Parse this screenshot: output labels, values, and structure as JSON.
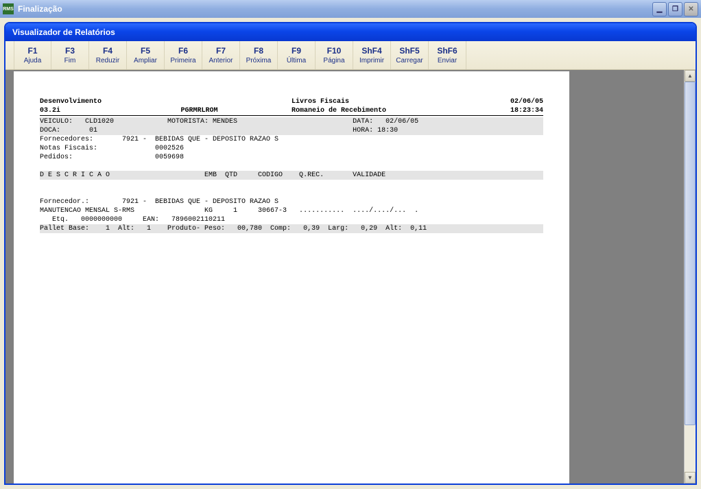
{
  "outer_window": {
    "title": "Finalização",
    "icon_text": "RMS"
  },
  "inner_window": {
    "title": "Visualizador de Relatórios"
  },
  "toolbar": [
    {
      "key": "F1",
      "label": "Ajuda"
    },
    {
      "key": "F3",
      "label": "Fim"
    },
    {
      "key": "F4",
      "label": "Reduzir"
    },
    {
      "key": "F5",
      "label": "Ampliar"
    },
    {
      "key": "F6",
      "label": "Primeira"
    },
    {
      "key": "F7",
      "label": "Anterior"
    },
    {
      "key": "F8",
      "label": "Próxima"
    },
    {
      "key": "F9",
      "label": "Última"
    },
    {
      "key": "F10",
      "label": "Página"
    },
    {
      "key": "ShF4",
      "label": "Imprimir"
    },
    {
      "key": "ShF5",
      "label": "Carregar"
    },
    {
      "key": "ShF6",
      "label": "Enviar"
    }
  ],
  "report": {
    "header": {
      "line1_left": "Desenvolvimento",
      "line1_mid": "Livros Fiscais",
      "line1_right": "02/06/05",
      "line2_left": "03.2i",
      "line2_mid_l": "PGRMRLROM",
      "line2_mid_r": "Romaneio de Recebimento",
      "line2_right": "18:23:34"
    },
    "band1": "VEICULO:   CLD1020             MOTORISTA: MENDES                            DATA:   02/06/05",
    "band2": "DOCA:       01                                                              HORA: 18:30",
    "row_forn": "Fornecedores:       7921 -  BEBIDAS QUE - DEPOSITO RAZAO S",
    "row_nf": "Notas Fiscais:              0002526",
    "row_ped": "Pedidos:                    0059698",
    "band_desc": "D E S C R I C A O                       EMB  QTD     CODIGO    Q.REC.       VALIDADE",
    "row_forn2": "Fornecedor.:        7921 -  BEBIDAS QUE - DEPOSITO RAZAO S",
    "row_manut": "MANUTENCAO MENSAL S-RMS                 KG     1     30667-3   ...........  ..../..../...  .",
    "row_etq": "   Etq.   0000000000     EAN:   7896002110211",
    "band_pallet": "Pallet Base:    1  Alt:   1    Produto- Peso:   00,780  Comp:   0,39  Larg:   0,29  Alt:  0,11"
  }
}
